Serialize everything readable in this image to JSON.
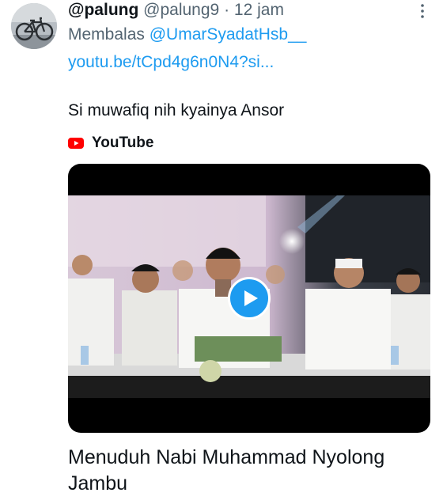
{
  "tweet": {
    "display_name": "@palung",
    "handle": "@palung9",
    "separator": "·",
    "time": "12 jam",
    "reply_prefix": "Membalas",
    "reply_to": "@UmarSyadatHsb__",
    "link": "youtu.be/tCpd4g6n0N4?si...",
    "text": "Si muwafiq nih kyainya Ansor",
    "avatar_icon": "bicycle-avatar",
    "more_icon": "more-vertical-icon"
  },
  "card": {
    "source_icon": "youtube-icon",
    "source_name": "YouTube",
    "play_icon": "play-icon",
    "title": "Menuduh Nabi Muhammad Nyolong Jambu"
  },
  "colors": {
    "accent": "#1d9bf0",
    "text_primary": "#0f1419",
    "text_secondary": "#536471",
    "youtube_red": "#ff0000"
  }
}
